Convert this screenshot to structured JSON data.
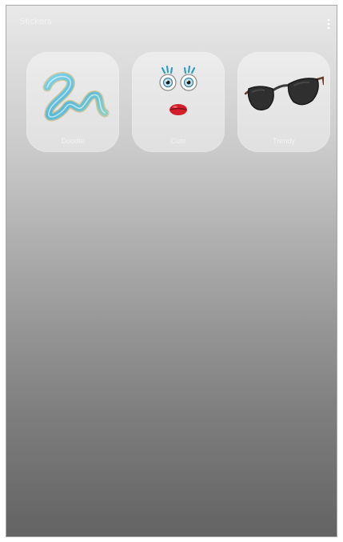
{
  "header": {
    "title": "Stickers",
    "more_icon": "more-vertical-icon"
  },
  "stickers": [
    {
      "label": "Doodle",
      "icon": "squiggle-doodle-icon"
    },
    {
      "label": "Cute",
      "icon": "cartoon-face-icon"
    },
    {
      "label": "Trendy",
      "icon": "sunglasses-icon"
    }
  ],
  "colors": {
    "gradient_top": "#e9e9e9",
    "gradient_bottom": "#636363",
    "tile_fill": "rgba(255,255,255,0.42)",
    "lips": "#d21f2a",
    "lens": "#2f2f2f"
  }
}
